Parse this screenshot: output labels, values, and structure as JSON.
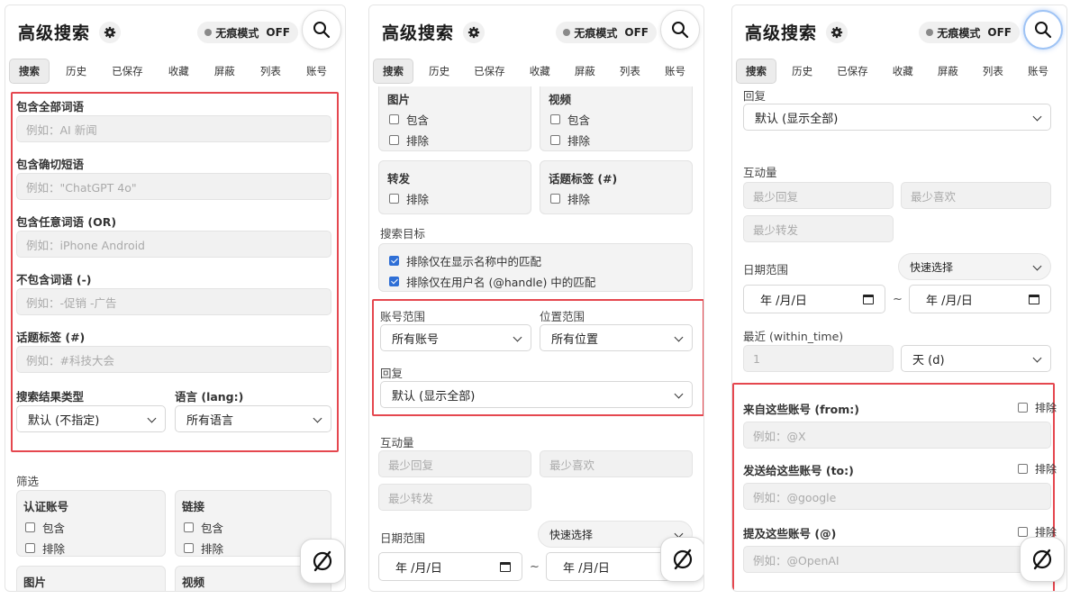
{
  "header": {
    "title": "高级搜索",
    "incognito_label": "无痕模式",
    "incognito_state": "OFF"
  },
  "tabs": [
    "搜索",
    "历史",
    "已保存",
    "收藏",
    "屏蔽",
    "列表",
    "账号"
  ],
  "active_tab": "搜索",
  "colors": {
    "highlight_border": "#e5474f",
    "checkbox_checked": "#2f6fd6"
  },
  "icons": {
    "settings": "gear-icon",
    "search": "search-icon",
    "fab": "slash-circle-icon"
  },
  "panel1": {
    "all_words": {
      "label": "包含全部词语",
      "placeholder": "例如：AI 新闻"
    },
    "exact_phrase": {
      "label": "包含确切短语",
      "placeholder": "例如：\"ChatGPT 4o\""
    },
    "any_words": {
      "label": "包含任意词语 (OR)",
      "placeholder": "例如：iPhone Android"
    },
    "none_words": {
      "label": "不包含词语 (-)",
      "placeholder": "例如：-促销 -广告"
    },
    "hashtags": {
      "label": "话题标签 (#)",
      "placeholder": "例如：#科技大会"
    },
    "result_type": {
      "label": "搜索结果类型",
      "value": "默认 (不指定)"
    },
    "language": {
      "label": "语言 (lang:)",
      "value": "所有语言"
    },
    "filters": {
      "label": "筛选"
    },
    "verified": {
      "label": "认证账号",
      "include": "包含",
      "exclude": "排除"
    },
    "links": {
      "label": "链接",
      "include": "包含",
      "exclude": "排除"
    },
    "images": {
      "label": "图片"
    },
    "videos": {
      "label": "视频"
    }
  },
  "panel2": {
    "images": {
      "label": "图片",
      "include": "包含",
      "exclude": "排除"
    },
    "videos": {
      "label": "视频",
      "include": "包含",
      "exclude": "排除"
    },
    "retweets": {
      "label": "转发",
      "exclude": "排除"
    },
    "hashtag_filter": {
      "label": "话题标签 (#)",
      "exclude": "排除"
    },
    "search_target": {
      "label": "搜索目标",
      "exclude_display_name": "排除仅在显示名称中的匹配",
      "exclude_handle": "排除仅在用户名 (@handle) 中的匹配"
    },
    "account_scope": {
      "label": "账号范围",
      "value": "所有账号"
    },
    "location_scope": {
      "label": "位置范围",
      "value": "所有位置"
    },
    "replies": {
      "label": "回复",
      "value": "默认 (显示全部)"
    },
    "engagement": {
      "label": "互动量",
      "min_replies": "最少回复",
      "min_likes": "最少喜欢",
      "min_retweets": "最少转发"
    },
    "date_range": {
      "label": "日期范围",
      "quick_select": "快速选择",
      "start": "年 /月/日",
      "end": "年 /月/日",
      "separator": "~"
    }
  },
  "panel3": {
    "replies": {
      "label": "回复",
      "value": "默认 (显示全部)"
    },
    "engagement": {
      "label": "互动量",
      "min_replies": "最少回复",
      "min_likes": "最少喜欢",
      "min_retweets": "最少转发"
    },
    "date_range": {
      "label": "日期范围",
      "quick_select": "快速选择",
      "start": "年 /月/日",
      "end": "年 /月/日",
      "separator": "~"
    },
    "recent": {
      "label": "最近 (within_time)",
      "value": "1",
      "unit": "天 (d)"
    },
    "from": {
      "label": "来自这些账号 (from:)",
      "exclude": "排除",
      "placeholder": "例如：@X"
    },
    "to": {
      "label": "发送给这些账号 (to:)",
      "exclude": "排除",
      "placeholder": "例如：@google"
    },
    "mentions": {
      "label": "提及这些账号 (@)",
      "exclude": "排除",
      "placeholder": "例如：@OpenAI"
    }
  }
}
